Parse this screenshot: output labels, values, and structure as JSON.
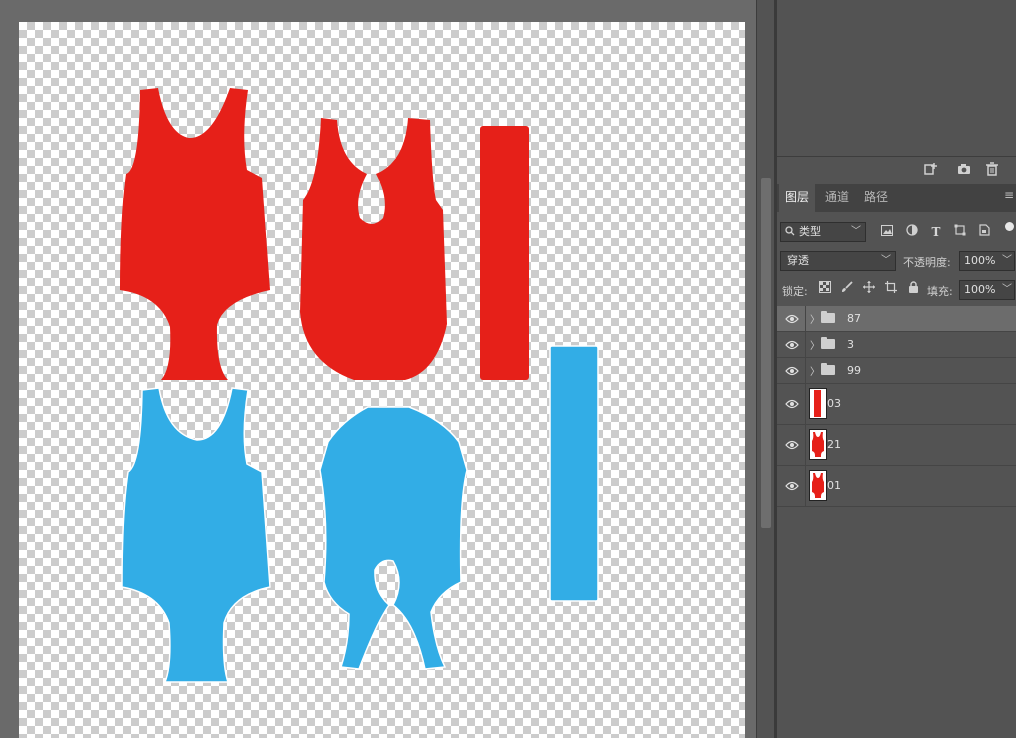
{
  "colors": {
    "red": "#e62019",
    "blue": "#32ade6",
    "panel_bg": "#535353",
    "selected_row": "#6c6c6c"
  },
  "canvas": {
    "shapes": [
      {
        "name": "red-front-piece",
        "color": "red"
      },
      {
        "name": "red-back-piece",
        "color": "red"
      },
      {
        "name": "red-strip",
        "color": "red"
      },
      {
        "name": "blue-front-piece",
        "color": "blue"
      },
      {
        "name": "blue-back-piece",
        "color": "blue"
      },
      {
        "name": "blue-strip",
        "color": "blue"
      }
    ]
  },
  "panel": {
    "toolbar_icons": [
      "new-layer-icon",
      "camera-icon",
      "trash-icon"
    ],
    "tabs": [
      {
        "label": "图层",
        "active": true
      },
      {
        "label": "通道",
        "active": false
      },
      {
        "label": "路径",
        "active": false
      }
    ],
    "menu_icon": "≡",
    "filter": {
      "value": "类型",
      "icons": [
        "image-filter-icon",
        "adjustment-filter-icon",
        "text-filter-icon",
        "shape-filter-icon",
        "smart-object-filter-icon"
      ]
    },
    "blend_mode": "穿透",
    "opacity_label": "不透明度:",
    "opacity_value": "100%",
    "lock_label": "锁定:",
    "lock_icons": [
      "lock-transparent-icon",
      "lock-paint-icon",
      "lock-move-icon",
      "lock-artboard-icon",
      "lock-all-icon"
    ],
    "fill_label": "填充:",
    "fill_value": "100%",
    "layers": [
      {
        "name": "87",
        "type": "group",
        "selected": true
      },
      {
        "name": "3",
        "type": "group",
        "selected": false
      },
      {
        "name": "99",
        "type": "group",
        "selected": false
      },
      {
        "name": "03",
        "type": "layer",
        "thumb": "strip",
        "selected": false
      },
      {
        "name": "21",
        "type": "layer",
        "thumb": "suit",
        "selected": false
      },
      {
        "name": "01",
        "type": "layer",
        "thumb": "suit",
        "selected": false
      }
    ]
  }
}
